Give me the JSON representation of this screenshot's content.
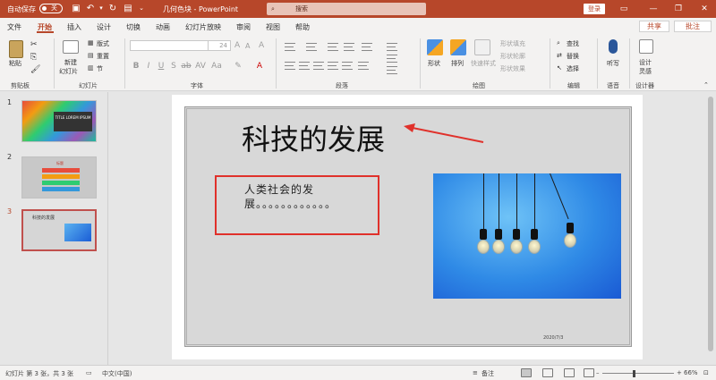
{
  "titlebar": {
    "autosave_label": "自动保存",
    "autosave_state": "关",
    "doc_title": "几何色块 - PowerPoint",
    "search_placeholder": "搜索",
    "login_label": "登录",
    "accent": "#b7472a"
  },
  "tabs": [
    "文件",
    "开始",
    "插入",
    "设计",
    "切换",
    "动画",
    "幻灯片放映",
    "审阅",
    "视图",
    "帮助"
  ],
  "active_tab": "开始",
  "share_label": "共享",
  "comment_label": "批注",
  "ribbon": {
    "clipboard": {
      "paste": "粘贴",
      "group": "剪贴板"
    },
    "slides": {
      "new_slide_1": "新建",
      "new_slide_2": "幻灯片",
      "layout": "版式",
      "reset": "重置",
      "section": "节",
      "group": "幻灯片"
    },
    "font": {
      "size": "24",
      "group": "字体"
    },
    "paragraph": {
      "group": "段落"
    },
    "drawing": {
      "shapes": "形状",
      "arrange": "排列",
      "quick_styles": "快速样式",
      "fill": "形状填充",
      "outline": "形状轮廓",
      "effects": "形状效果",
      "group": "绘图"
    },
    "editing": {
      "find": "查找",
      "replace": "替换",
      "select": "选择",
      "group": "编辑"
    },
    "voice": {
      "dictate": "听写",
      "group": "语音"
    },
    "designer": {
      "label_1": "设计",
      "label_2": "灵感",
      "group": "设计器"
    }
  },
  "thumbnails": [
    {
      "num": "1",
      "text": "TITLE LOREM IPSUM"
    },
    {
      "num": "2",
      "text": "标题"
    },
    {
      "num": "3",
      "text": "科技的发展"
    }
  ],
  "slide": {
    "title": "科技的发展",
    "body": "人类社会的发展。。。。。。。。。。。。",
    "date": "2020/7/3"
  },
  "statusbar": {
    "slide_info": "幻灯片 第 3 张，共 3 张",
    "language": "中文(中国)",
    "notes": "备注",
    "zoom": "66%"
  }
}
